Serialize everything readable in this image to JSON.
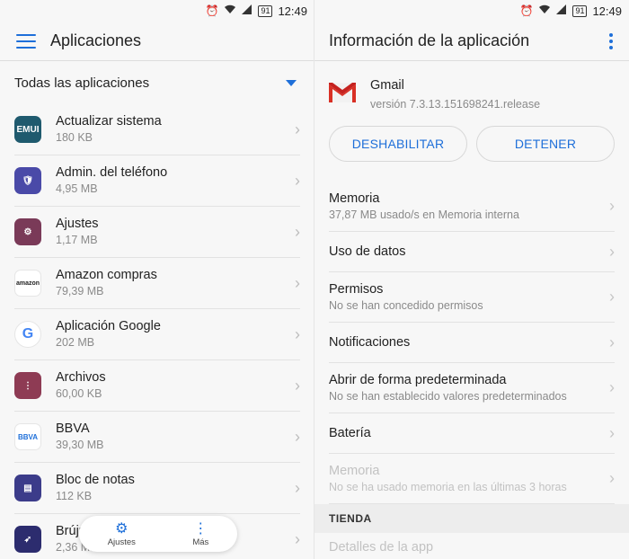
{
  "status": {
    "time": "12:49",
    "battery": "91"
  },
  "left": {
    "title": "Aplicaciones",
    "filter": "Todas las aplicaciones",
    "apps": [
      {
        "name": "Actualizar sistema",
        "size": "180 KB",
        "icon": "emui-icon",
        "color": "#1f5a6e",
        "glyph": "EMUI"
      },
      {
        "name": "Admin. del teléfono",
        "size": "4,95 MB",
        "icon": "shield-icon",
        "color": "#4a4aa8",
        "glyph": "🛡"
      },
      {
        "name": "Ajustes",
        "size": "1,17 MB",
        "icon": "gear-icon",
        "color": "#7a3a58",
        "glyph": "⚙"
      },
      {
        "name": "Amazon compras",
        "size": "79,39 MB",
        "icon": "amazon-icon",
        "color": "#ffffff",
        "glyph": "amazon"
      },
      {
        "name": "Aplicación Google",
        "size": "202 MB",
        "icon": "google-icon",
        "color": "#ffffff",
        "glyph": "G"
      },
      {
        "name": "Archivos",
        "size": "60,00 KB",
        "icon": "folder-icon",
        "color": "#8e3b54",
        "glyph": "⋮"
      },
      {
        "name": "BBVA",
        "size": "39,30 MB",
        "icon": "bbva-icon",
        "color": "#ffffff",
        "glyph": "BBVA"
      },
      {
        "name": "Bloc de notas",
        "size": "112 KB",
        "icon": "notepad-icon",
        "color": "#3c3c8a",
        "glyph": "▤"
      },
      {
        "name": "Brújula",
        "size": "2,36 MB",
        "icon": "compass-icon",
        "color": "#2c2c6e",
        "glyph": "➶"
      }
    ],
    "bottom_nav": [
      {
        "label": "Ajustes",
        "icon": "settings-icon"
      },
      {
        "label": "Más",
        "icon": "more-vertical-icon"
      }
    ]
  },
  "right": {
    "title": "Información de la aplicación",
    "app_name": "Gmail",
    "app_version": "versión 7.3.13.151698241.release",
    "btn_disable": "DESHABILITAR",
    "btn_stop": "DETENER",
    "items": [
      {
        "title": "Memoria",
        "sub": "37,87 MB usado/s en Memoria interna",
        "disabled": false
      },
      {
        "title": "Uso de datos",
        "sub": "",
        "disabled": false
      },
      {
        "title": "Permisos",
        "sub": "No se han concedido permisos",
        "disabled": false
      },
      {
        "title": "Notificaciones",
        "sub": "",
        "disabled": false
      },
      {
        "title": "Abrir de forma predeterminada",
        "sub": "No se han establecido valores predeterminados",
        "disabled": false
      },
      {
        "title": "Batería",
        "sub": "",
        "disabled": false
      },
      {
        "title": "Memoria",
        "sub": "No se ha usado memoria en las últimas 3 horas",
        "disabled": true
      }
    ],
    "section": "TIENDA",
    "store_item": "Detalles de la app"
  },
  "colors": {
    "accent": "#1e6fd9",
    "background": "#f7f7f7"
  }
}
